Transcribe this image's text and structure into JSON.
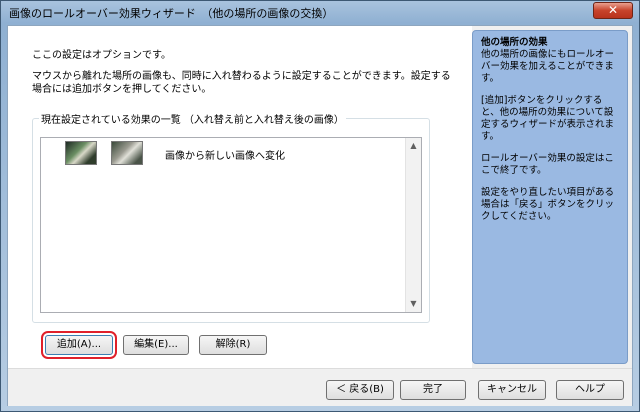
{
  "window": {
    "title": "画像のロールオーバー効果ウィザード　（他の場所の画像の交換）",
    "close_label": "✕"
  },
  "main": {
    "intro1": "ここの設定はオプションです。",
    "intro2": "マウスから離れた場所の画像も、同時に入れ替わるように設定することができます。設定する場合には追加ボタンを押してください。",
    "group_label": "現在設定されている効果の一覧 （入れ替え前と入れ替え後の画像）",
    "items": [
      {
        "text": "画像から新しい画像へ変化"
      }
    ],
    "buttons": {
      "add": "追加(A)...",
      "edit": "編集(E)...",
      "delete": "解除(R)"
    }
  },
  "side_panel": {
    "title": "他の場所の効果",
    "p1": "他の場所の画像にもロールオーバー効果を加えることができます。",
    "p2": "[追加]ボタンをクリックすると、他の場所の効果について設定するウィザードが表示されます。",
    "p3": "ロールオーバー効果の設定はここで終了です。",
    "p4": "設定をやり直したい項目がある場合は「戻る」ボタンをクリックしてください。"
  },
  "footer": {
    "back": "＜ 戻る(B)",
    "finish": "完了",
    "cancel": "キャンセル",
    "help": "ヘルプ"
  },
  "colors": {
    "highlight": "#e0202a",
    "side_panel_bg": "#9ab9e2"
  }
}
